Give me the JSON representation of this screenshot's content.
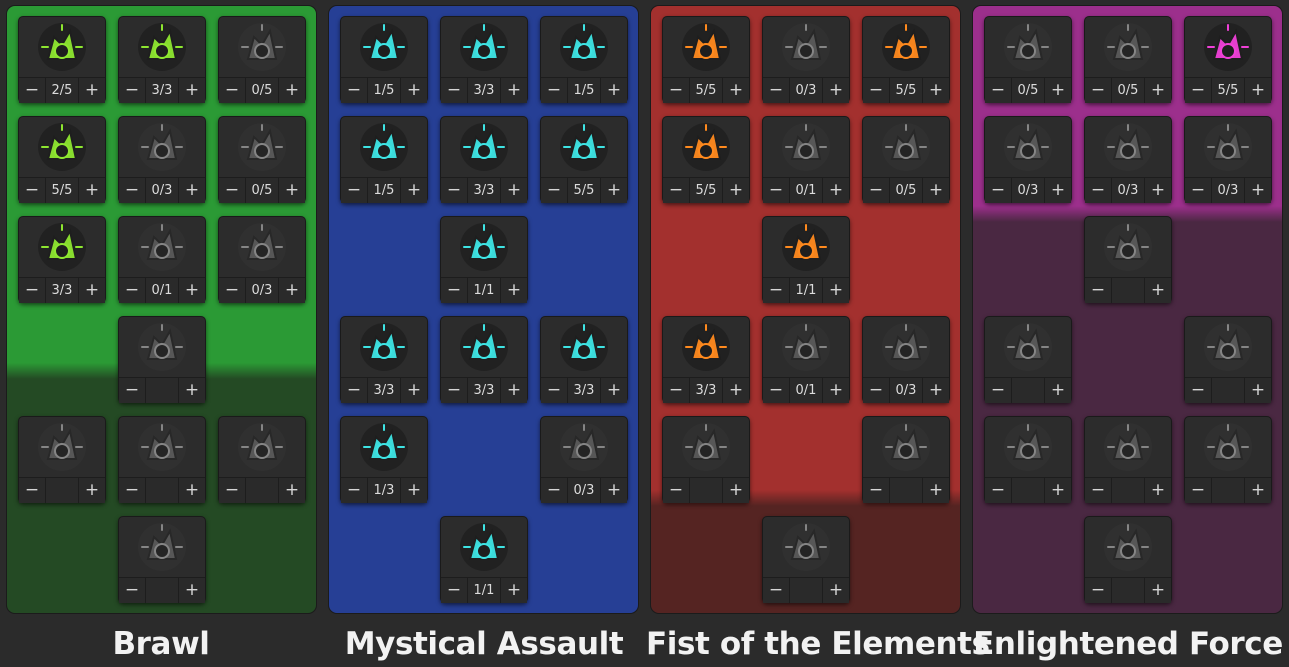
{
  "trees": [
    {
      "id": "brawl",
      "name": "Brawl",
      "top_color": "#2b9a35",
      "bottom_color": "#244a24",
      "accent": "#8ee630",
      "nodes": [
        {
          "row": 0,
          "col": 0,
          "value": "2/5",
          "icon": "goblin-gate-icon",
          "lit": true
        },
        {
          "row": 0,
          "col": 1,
          "value": "3/3",
          "icon": "spiked-fist-burst-icon",
          "lit": true
        },
        {
          "row": 0,
          "col": 2,
          "value": "0/5",
          "icon": "shattered-plus-orb-icon",
          "lit": false
        },
        {
          "row": 1,
          "col": 0,
          "value": "5/5",
          "icon": "octopus-icon",
          "lit": true
        },
        {
          "row": 1,
          "col": 1,
          "value": "0/3",
          "icon": "skull-helmet-icon",
          "lit": false
        },
        {
          "row": 1,
          "col": 2,
          "value": "0/5",
          "icon": "swirl-arrows-icon",
          "lit": false
        },
        {
          "row": 2,
          "col": 0,
          "value": "3/3",
          "icon": "bandaged-shield-icon",
          "lit": true
        },
        {
          "row": 2,
          "col": 1,
          "value": "0/1",
          "icon": "scythe-burst-icon",
          "lit": false
        },
        {
          "row": 2,
          "col": 2,
          "value": "0/3",
          "icon": "leaping-rabbit-icon",
          "lit": false
        },
        {
          "row": 3,
          "col": 1,
          "value": "",
          "icon": "spiked-drill-icon",
          "lit": false
        },
        {
          "row": 4,
          "col": 0,
          "value": "",
          "icon": "crackling-fist-icon",
          "lit": false
        },
        {
          "row": 4,
          "col": 1,
          "value": "",
          "icon": "crossed-bones-fist-icon",
          "lit": false
        },
        {
          "row": 4,
          "col": 2,
          "value": "",
          "icon": "winged-spirit-icon",
          "lit": false
        },
        {
          "row": 5,
          "col": 1,
          "value": "",
          "icon": "bomb-blast-icon",
          "lit": false
        }
      ]
    },
    {
      "id": "mystical-assault",
      "name": "Mystical Assault",
      "top_color": "#263f95",
      "bottom_color": "#263f95",
      "accent": "#3ee4e4",
      "nodes": [
        {
          "row": 0,
          "col": 0,
          "value": "1/5",
          "icon": "twin-skulls-icon",
          "lit": true
        },
        {
          "row": 0,
          "col": 1,
          "value": "3/3",
          "icon": "winged-pistol-icon",
          "lit": true
        },
        {
          "row": 0,
          "col": 2,
          "value": "1/5",
          "icon": "skull-banner-icon",
          "lit": true
        },
        {
          "row": 1,
          "col": 0,
          "value": "1/5",
          "icon": "curved-arrow-fist-icon",
          "lit": true
        },
        {
          "row": 1,
          "col": 1,
          "value": "3/3",
          "icon": "crosshair-burst-icon",
          "lit": true
        },
        {
          "row": 1,
          "col": 2,
          "value": "5/5",
          "icon": "arcane-cluster-icon",
          "lit": true
        },
        {
          "row": 2,
          "col": 1,
          "value": "1/1",
          "icon": "rising-flame-icon",
          "lit": true
        },
        {
          "row": 3,
          "col": 0,
          "value": "3/3",
          "icon": "crystal-shards-icon",
          "lit": true
        },
        {
          "row": 3,
          "col": 1,
          "value": "3/3",
          "icon": "skull-blade-icon",
          "lit": true
        },
        {
          "row": 3,
          "col": 2,
          "value": "3/3",
          "icon": "crossed-tools-icon",
          "lit": true
        },
        {
          "row": 4,
          "col": 0,
          "value": "1/3",
          "icon": "whirlwind-icon",
          "lit": true
        },
        {
          "row": 4,
          "col": 2,
          "value": "0/3",
          "icon": "crowned-skull-icon",
          "lit": false
        },
        {
          "row": 5,
          "col": 1,
          "value": "1/1",
          "icon": "rune-orb-icon",
          "lit": true
        }
      ]
    },
    {
      "id": "fist-of-the-elements",
      "name": "Fist of the Elements",
      "top_color": "#a3302e",
      "bottom_color": "#552422",
      "accent": "#ff8a1e",
      "nodes": [
        {
          "row": 0,
          "col": 0,
          "value": "5/5",
          "icon": "hourglass-flame-icon",
          "lit": true
        },
        {
          "row": 0,
          "col": 1,
          "value": "0/3",
          "icon": "crosshair-fist-icon",
          "lit": false
        },
        {
          "row": 0,
          "col": 2,
          "value": "5/5",
          "icon": "chain-lightning-icon",
          "lit": true
        },
        {
          "row": 1,
          "col": 0,
          "value": "5/5",
          "icon": "burning-skull-icon",
          "lit": true
        },
        {
          "row": 1,
          "col": 1,
          "value": "0/1",
          "icon": "gauntlet-shield-icon",
          "lit": false
        },
        {
          "row": 1,
          "col": 2,
          "value": "0/5",
          "icon": "skull-pile-icon",
          "lit": false
        },
        {
          "row": 2,
          "col": 1,
          "value": "1/1",
          "icon": "skull-hands-icon",
          "lit": true
        },
        {
          "row": 3,
          "col": 0,
          "value": "3/3",
          "icon": "lightning-feather-icon",
          "lit": true
        },
        {
          "row": 3,
          "col": 1,
          "value": "0/1",
          "icon": "flaming-bar-icon",
          "lit": false
        },
        {
          "row": 3,
          "col": 2,
          "value": "0/3",
          "icon": "mushroom-skull-icon",
          "lit": false
        },
        {
          "row": 4,
          "col": 0,
          "value": "",
          "icon": "heart-fist-icon",
          "lit": false
        },
        {
          "row": 4,
          "col": 2,
          "value": "",
          "icon": "serpent-coil-icon",
          "lit": false
        },
        {
          "row": 5,
          "col": 1,
          "value": "",
          "icon": "smoking-gun-icon",
          "lit": false
        }
      ]
    },
    {
      "id": "enlightened-force",
      "name": "Enlightened Force",
      "top_color": "#9c2f8c",
      "bottom_color": "#4a2842",
      "accent": "#f040d8",
      "nodes": [
        {
          "row": 0,
          "col": 0,
          "value": "0/5",
          "icon": "quartered-shield-icon",
          "lit": false
        },
        {
          "row": 0,
          "col": 1,
          "value": "0/5",
          "icon": "clenched-fist-icon",
          "lit": false
        },
        {
          "row": 0,
          "col": 2,
          "value": "5/5",
          "icon": "flying-bird-icon",
          "lit": true
        },
        {
          "row": 1,
          "col": 0,
          "value": "0/3",
          "icon": "potion-bottle-icon",
          "lit": false
        },
        {
          "row": 1,
          "col": 1,
          "value": "0/3",
          "icon": "armored-fist-icon",
          "lit": false
        },
        {
          "row": 1,
          "col": 2,
          "value": "0/3",
          "icon": "healing-fist-icon",
          "lit": false
        },
        {
          "row": 2,
          "col": 1,
          "value": "",
          "icon": "glowing-fist-icon",
          "lit": false
        },
        {
          "row": 3,
          "col": 0,
          "value": "",
          "icon": "rising-fist-icon",
          "lit": false
        },
        {
          "row": 3,
          "col": 2,
          "value": "",
          "icon": "portrait-medallion-icon",
          "lit": false
        },
        {
          "row": 4,
          "col": 0,
          "value": "",
          "icon": "sword-splash-icon",
          "lit": false
        },
        {
          "row": 4,
          "col": 1,
          "value": "",
          "icon": "crystal-burst-icon",
          "lit": false
        },
        {
          "row": 4,
          "col": 2,
          "value": "",
          "icon": "radiant-star-icon",
          "lit": false
        },
        {
          "row": 5,
          "col": 1,
          "value": "",
          "icon": "shadow-creature-icon",
          "lit": false
        }
      ]
    }
  ],
  "controls": {
    "minus": "−",
    "plus": "+"
  }
}
